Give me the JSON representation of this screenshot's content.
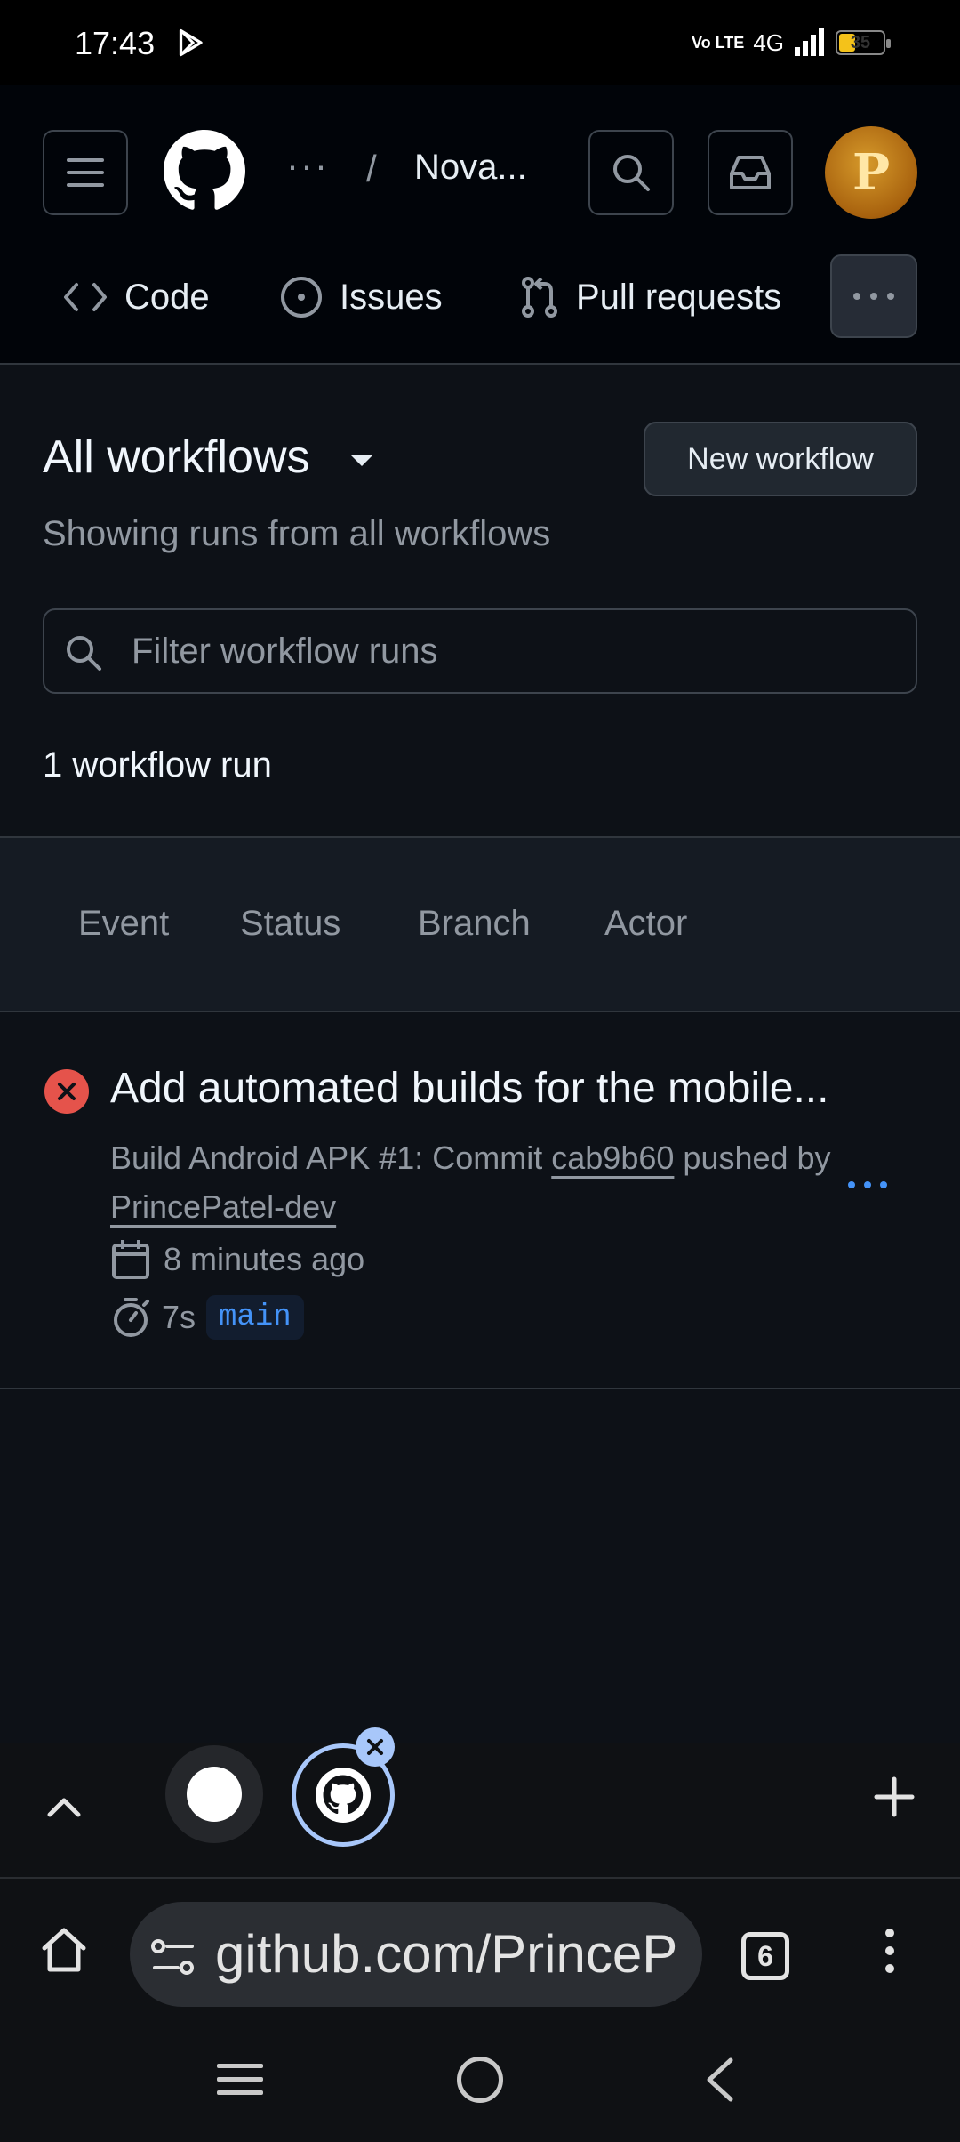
{
  "status_bar": {
    "time": "17:43",
    "volte": "Vo LTE",
    "network": "4G",
    "battery": "35",
    "battery_level": 0.35
  },
  "header": {
    "breadcrumb_dots": "···",
    "breadcrumb_sep": "/",
    "repo": "Nova...",
    "avatar_letter": "P",
    "icons": [
      "menu-icon",
      "github-logo-icon",
      "search-icon",
      "inbox-icon"
    ]
  },
  "repo_tabs": [
    {
      "label": "Code",
      "icon": "code-icon"
    },
    {
      "label": "Issues",
      "icon": "issue-opened-icon"
    },
    {
      "label": "Pull requests",
      "icon": "git-pull-request-icon"
    }
  ],
  "main": {
    "title": "All workflows",
    "new_workflow_label": "New workflow",
    "subtitle": "Showing runs from all workflows",
    "filter_placeholder": "Filter workflow runs",
    "run_count": "1 workflow run"
  },
  "filters": {
    "event": "Event",
    "status": "Status",
    "branch": "Branch",
    "actor": "Actor"
  },
  "run": {
    "title": "Add automated builds for the mobile...",
    "meta_prefix": "Build Android APK #1: Commit",
    "commit": "cab9b60",
    "meta_mid": "pushed by",
    "author": "PrincePatel-dev",
    "time_ago": "8 minutes ago",
    "duration": "7s",
    "branch": "main",
    "status": "failure",
    "status_color": "#e5534b"
  },
  "browser": {
    "url": "github.com/PrincePa",
    "tab_count": "6"
  },
  "colors": {
    "accent": "#4493f8",
    "background": "#0d1117",
    "header_bg": "#010409"
  }
}
